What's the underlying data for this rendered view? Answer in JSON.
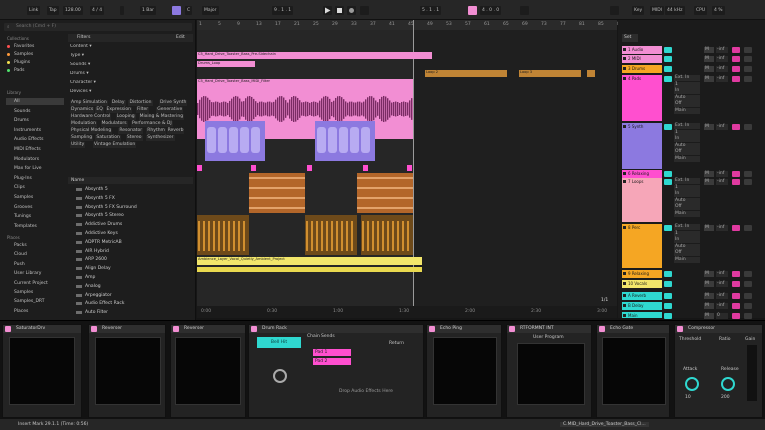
{
  "app": {
    "theme_colors": {
      "pink": "#f28ed3",
      "yellow": "#f2e66b",
      "orange": "#f5a623",
      "violet": "#8c79e0",
      "cyan": "#2fd8d0",
      "peach": "#f6a6b8",
      "magenta": "#ff4fcf"
    }
  },
  "topbar": {
    "link": "Link",
    "tap": "Tap",
    "tempo": "128.00",
    "signature": "4 / 4",
    "bar_mode": "1 Bar",
    "key": "C",
    "scale": "Major",
    "position": "9 . 1 . 1",
    "loop_start": "5 . 1 . 1",
    "loop_length": "4 . 0 . 0",
    "key_label": "Key",
    "midi_label": "MIDI",
    "midi_rate": "44 kHz",
    "cpu_label": "CPU",
    "cpu": "4 %",
    "icons": [
      "metronome-icon",
      "play-icon",
      "stop-icon",
      "record-icon",
      "arrangement-record-icon",
      "loop-icon",
      "draw-icon",
      "keyboard-icon"
    ]
  },
  "browser": {
    "search_placeholder": "Search (Cmd + F)",
    "collections_header": "Collections",
    "collections": [
      {
        "label": "Favorites",
        "color": "#ff5050"
      },
      {
        "label": "Samples",
        "color": "#ff9a3c"
      },
      {
        "label": "Plugins",
        "color": "#f5e04f"
      },
      {
        "label": "Pads",
        "color": "#4fe36c"
      }
    ],
    "library_header": "Library",
    "library": [
      "All",
      "Sounds",
      "Drums",
      "Instruments",
      "Audio Effects",
      "MIDI Effects",
      "Modulators",
      "Max for Live",
      "Plug-Ins",
      "Clips",
      "Samples",
      "Grooves",
      "Tunings",
      "Templates"
    ],
    "places_header": "Places",
    "places": [
      "Packs",
      "Cloud",
      "Push",
      "User Library",
      "Current Project",
      "Samples",
      "Samples_DRT",
      "Places"
    ],
    "filters_label": "Filters",
    "edit_label": "Edit",
    "filter_rows": [
      "Content",
      "Type",
      "Sounds",
      "Drums",
      "Character",
      "Devices"
    ],
    "tags": [
      "Amp Simulation",
      "Delay",
      "Distortion",
      "Drive Synth",
      "Dynamics",
      "EQ",
      "Expression",
      "Filter",
      "Generative",
      "Hardware Control",
      "Looping",
      "Mixing & Mastering",
      "Modulation",
      "Modulators",
      "Performance & DJ",
      "Physical Modeling",
      "Resonator",
      "Rhythm",
      "Reverb",
      "Sampling",
      "Saturation",
      "Stereo",
      "Synthesizer",
      "Utility",
      "Vintage Emulation"
    ],
    "results_header": "Name",
    "results": [
      "Absynth 5",
      "Absynth 5 FX",
      "Absynth 5 FX Surround",
      "Absynth 5 Stereo",
      "Addictive Drums",
      "Addictive Keys",
      "ADPTR MetricAB",
      "AIR Hybrid",
      "ARP 2600",
      "Align Delay",
      "Amp",
      "Analog",
      "Arpeggiator",
      "Audio Effect Rack",
      "Auto Filter"
    ]
  },
  "arrangement": {
    "ruler": [
      "1",
      "5",
      "9",
      "13",
      "17",
      "21",
      "25",
      "29",
      "33",
      "37",
      "41",
      "45",
      "49",
      "53",
      "57",
      "61",
      "65",
      "69",
      "73",
      "77",
      "81",
      "85",
      "89"
    ],
    "tracks": [
      {
        "clip": "C5_Hard_Drive_Toaster_Bass_Pre-Sidechain",
        "color": "#f28ed3"
      },
      {
        "clip": "Drums_Loop",
        "color": "#f28ed3"
      },
      {
        "clip": "C5_Hard_Drive_Toaster_Bass_MIDI_Filter",
        "color": "#f28ed3"
      },
      {
        "clip": "Synth",
        "color": "#8c79e0"
      },
      {
        "clip": "Hats",
        "color": "#f6a6b8"
      },
      {
        "clip": "Perc",
        "color": "#f5a623"
      },
      {
        "clip": "Ambience_Layer_Vocal_Quietly_Ambient_Project",
        "color": "#f2e66b"
      }
    ],
    "orange_clips": [
      "Loop 2",
      "Loop 3"
    ],
    "bottom_ruler": [
      "0:00",
      "0:30",
      "1:00",
      "1:30",
      "2:00",
      "2:30",
      "3:00"
    ],
    "zoom": "1/1"
  },
  "session": {
    "header": "Set",
    "tracks": [
      {
        "name": "1 Audio",
        "color": "#f28ed3",
        "mute_label": "M",
        "send": "-inf"
      },
      {
        "name": "2 MIDI",
        "color": "#f28ed3",
        "mute_label": "M",
        "send": "-inf"
      },
      {
        "name": "3 Drums",
        "color": "#f5a623",
        "mute_label": "M",
        "send": "-inf"
      },
      {
        "name": "4 Pads",
        "color": "#ff4fcf",
        "mute_label": "M",
        "send": "-inf"
      },
      {
        "name": "5 Synth",
        "color": "#8c79e0",
        "mute_label": "M",
        "send": "-inf"
      },
      {
        "name": "6 Relaxing",
        "color": "#ff4fcf",
        "mute_label": "M",
        "send": "-inf"
      },
      {
        "name": "7 Loops",
        "color": "#f6a6b8",
        "mute_label": "M",
        "send": "-inf"
      },
      {
        "name": "8 Perc",
        "color": "#f5a623",
        "mute_label": "M",
        "send": "-inf"
      },
      {
        "name": "9 Relaxing",
        "color": "#f5a623",
        "mute_label": "M",
        "send": "-inf"
      },
      {
        "name": "10 Vocals",
        "color": "#f2e66b",
        "mute_label": "M",
        "send": "-inf"
      },
      {
        "name": "A Reverb",
        "color": "#2fd8d0",
        "mute_label": "M",
        "send": "-inf"
      },
      {
        "name": "B Delay",
        "color": "#2fd8d0",
        "mute_label": "M",
        "send": "-inf"
      },
      {
        "name": "Main",
        "color": "#2fd8d0",
        "mute_label": "M",
        "send": "0"
      }
    ],
    "io_labels": [
      "Ext. In",
      "1",
      "In",
      "Auto",
      "Off",
      "Main"
    ]
  },
  "devices": [
    {
      "name": "SaturatorDrv"
    },
    {
      "name": "Reverser"
    },
    {
      "name": "Reverser"
    },
    {
      "name": "Drum Rack",
      "pad_name": "Bell Hit",
      "chain": "Chain",
      "sends": "Sends",
      "return": "Return",
      "drop_hint": "Drop Audio Effects Here",
      "pad_labels": [
        "Pad 1",
        "Pad 2"
      ]
    },
    {
      "name": "Echo Ping",
      "sub": "Off"
    },
    {
      "name": "RTFORMNT INT",
      "sub": "User Program"
    },
    {
      "name": "Echo Gate"
    },
    {
      "name": "Compressor",
      "threshold_label": "Threshold",
      "ratio_label": "Ratio",
      "attack_label": "Attack",
      "release_label": "Release",
      "gain_label": "Gain",
      "knobs": [
        "-12",
        "4.0",
        "10",
        "200"
      ]
    }
  ],
  "statusbar": {
    "left": "Insert Mark 29.1.1 (Time: 0:56)",
    "right": "C.MID_Hard_Drive_Toaster_Bass_Cl..."
  }
}
